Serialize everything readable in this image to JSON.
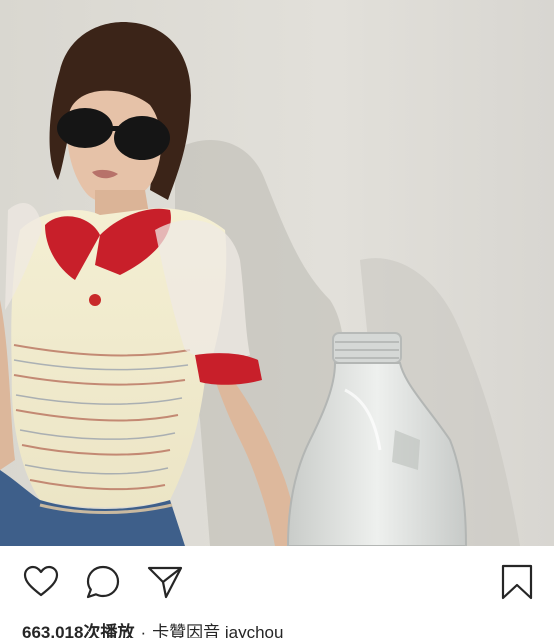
{
  "post": {
    "views_text": "663,018次播放",
    "separator": "·",
    "audio_text": "卡贊因音 jaychou"
  },
  "actions": {
    "like_icon": "heart-icon",
    "comment_icon": "comment-icon",
    "share_icon": "paper-plane-icon",
    "save_icon": "bookmark-icon"
  },
  "colors": {
    "icon_stroke": "#262626",
    "background": "#ffffff",
    "text": "#262626"
  }
}
